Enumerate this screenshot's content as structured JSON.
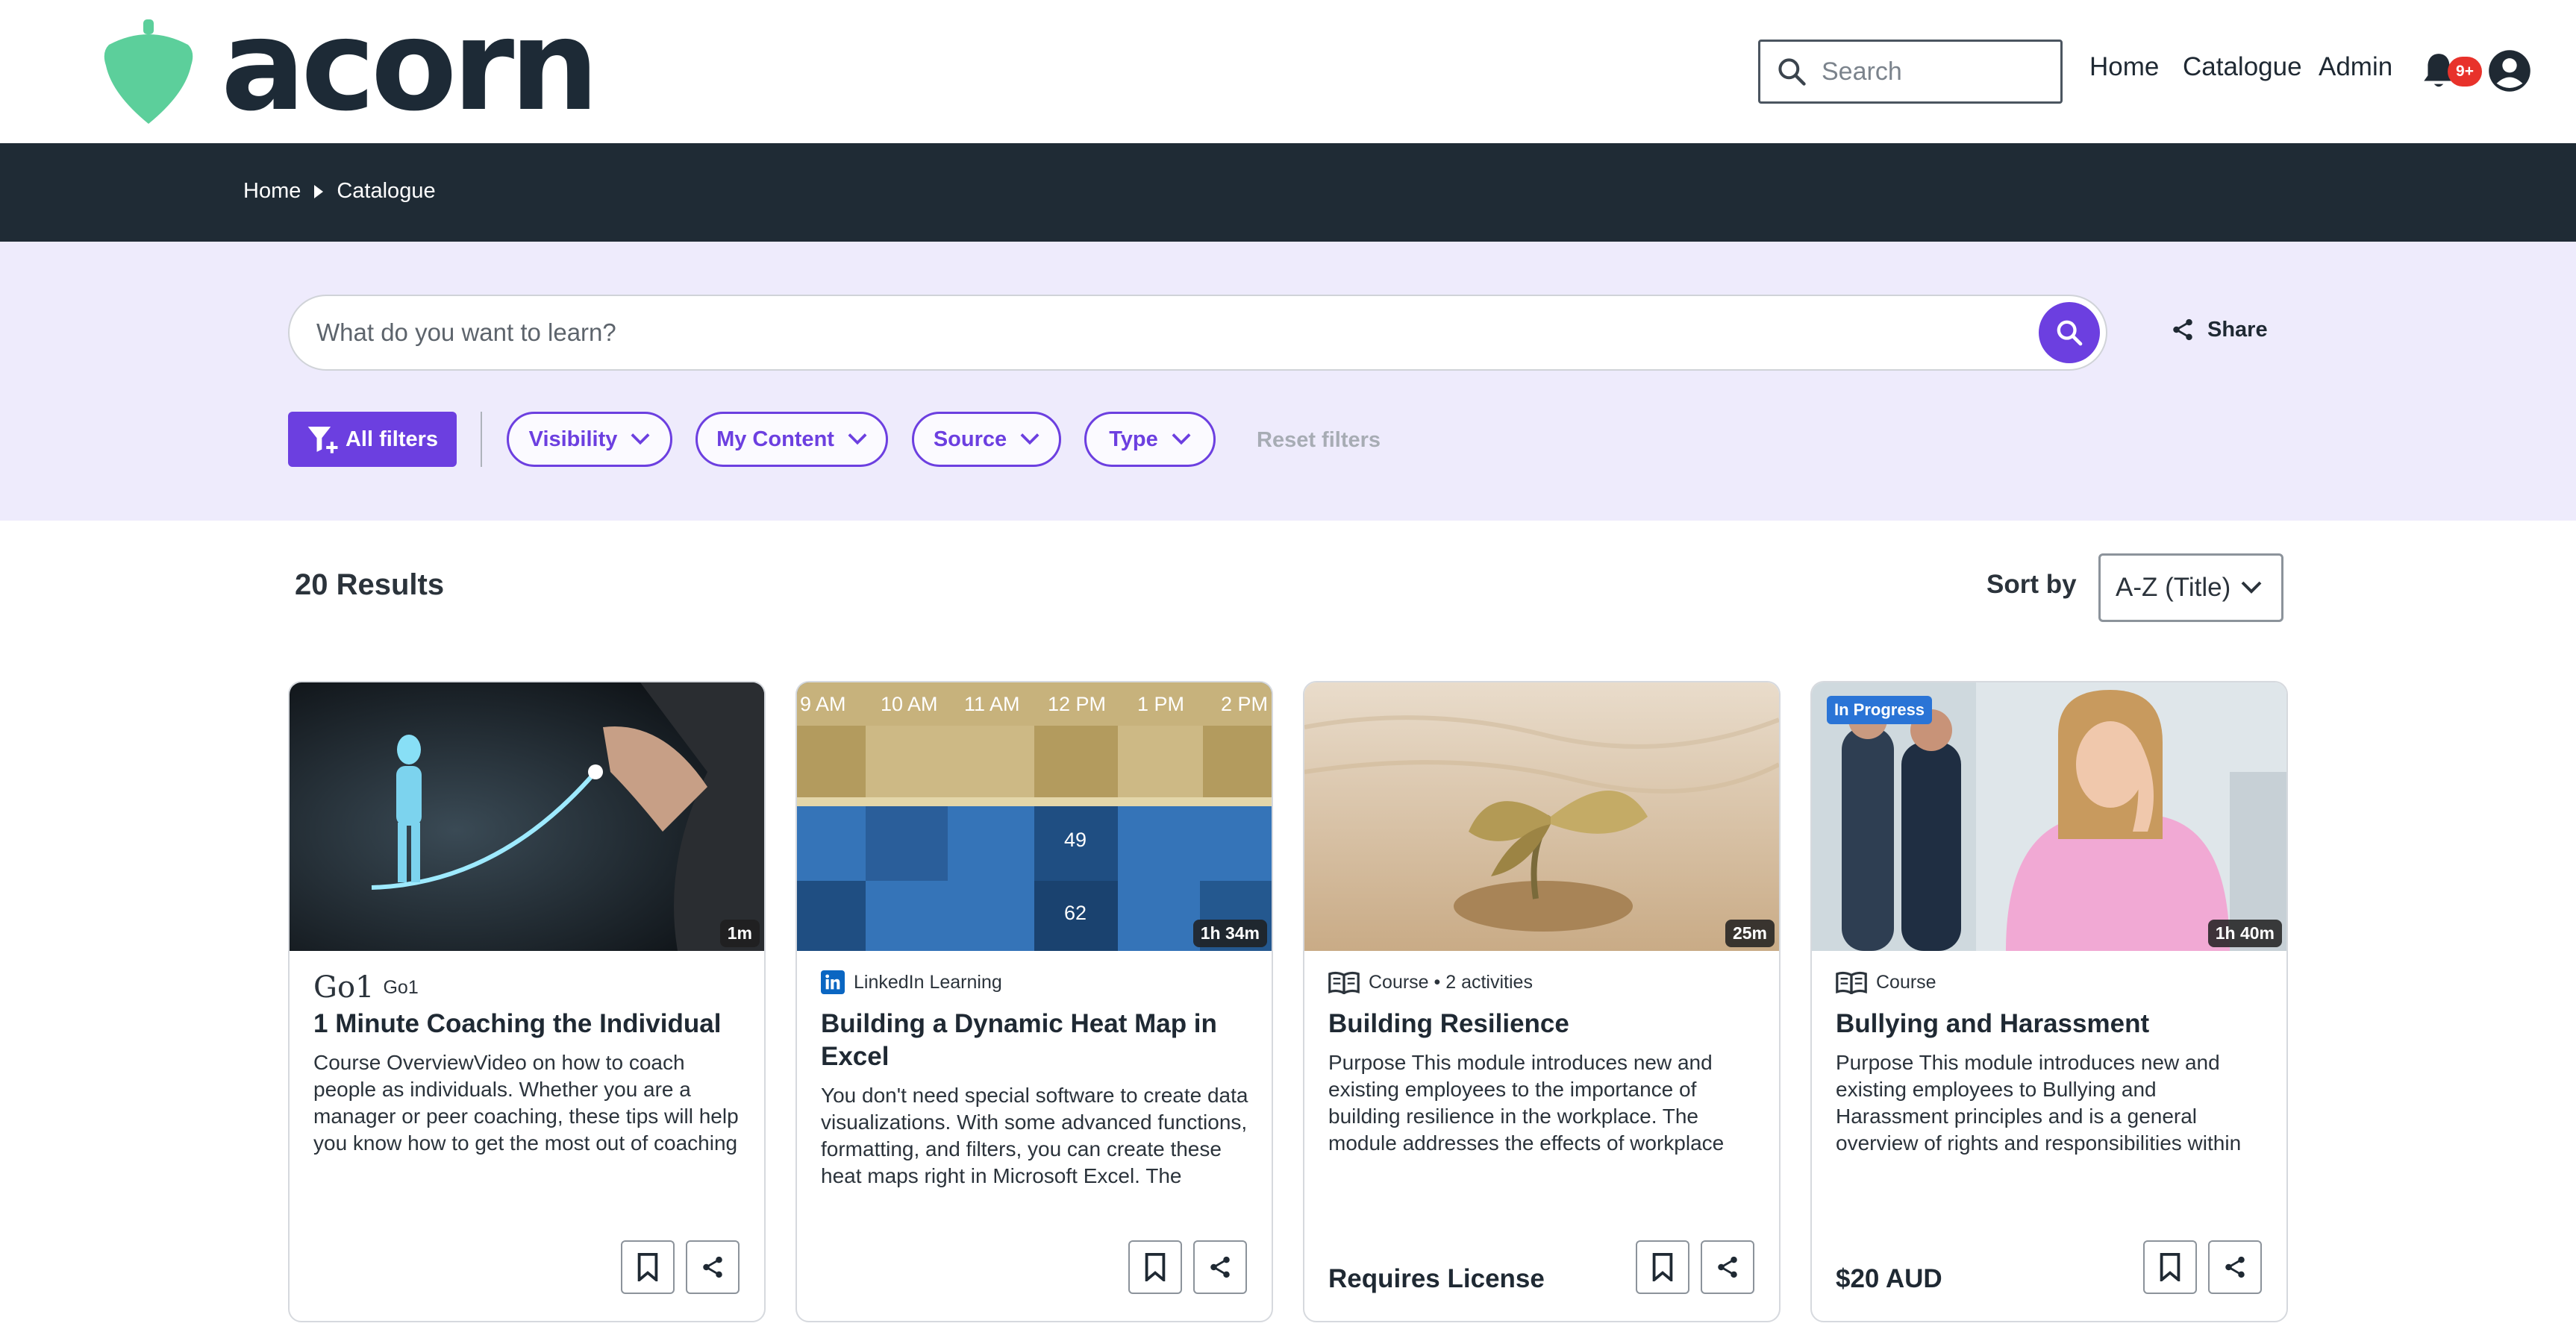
{
  "app": {
    "logo_text": "acorn",
    "accent_color": "#6c3fe0",
    "logo_color": "#5ccf9b"
  },
  "header": {
    "search_placeholder": "Search",
    "nav": [
      "Home",
      "Catalogue",
      "Admin"
    ],
    "notification_badge": "9+"
  },
  "breadcrumb": {
    "items": [
      "Home",
      "Catalogue"
    ]
  },
  "catalogue_search": {
    "placeholder": "What do you want to learn?",
    "share_label": "Share"
  },
  "filters": {
    "all_filters": "All filters",
    "visibility": "Visibility",
    "my_content": "My Content",
    "source": "Source",
    "type": "Type",
    "reset": "Reset filters"
  },
  "results": {
    "count_label": "20 Results",
    "sort_label": "Sort by",
    "sort_value": "A-Z (Title)"
  },
  "cards": [
    {
      "provider": "Go1",
      "provider_logo": "Go1",
      "duration": "1m",
      "title": "1 Minute Coaching the Individual",
      "description": "Course OverviewVideo on how to coach people as individuals. Whether you are a manager or peer coaching, these tips will help you know how to get the most out of coaching people recognising everyone responds in different ways.",
      "footer_label": ""
    },
    {
      "provider": "LinkedIn Learning",
      "provider_logo": "in",
      "duration": "1h 34m",
      "title": "Building a Dynamic Heat Map in Excel",
      "description": "You don't need special software to create data visualizations. With some advanced functions, formatting, and filters, you can create these heat maps right in Microsoft Excel. The techniques shown in this course…",
      "footer_label": "",
      "image_times": [
        "9 AM",
        "10 AM",
        "11 AM",
        "12 PM",
        "1 PM",
        "2 PM"
      ],
      "image_values": [
        "49",
        "62"
      ]
    },
    {
      "provider": "Course • 2 activities",
      "duration": "25m",
      "title": "Building Resilience",
      "description": "Purpose  This module introduces new and existing employees to the importance of building resilience in the workplace.  The module addresses the effects of workplace events on individual stress and goal-achievement, and how building resilience…",
      "footer_label": "Requires License"
    },
    {
      "provider": "Course",
      "duration": "1h 40m",
      "badge": "In Progress",
      "title": "Bullying and Harassment",
      "description": "Purpose  This module introduces new and existing employees to Bullying and Harassment principles and is a general overview of rights and responsibilities within the workplace.   The module addresses various stakeholders with their…",
      "footer_label": "$20 AUD"
    }
  ],
  "icons": {
    "logo": "acorn-icon",
    "search": "search-icon",
    "bell": "bell-icon",
    "user": "user-circle-icon",
    "share": "share-icon",
    "filter": "filter-plus-icon",
    "chevron": "chevron-down-icon",
    "bookmark": "bookmark-icon",
    "course": "book-icon",
    "linkedin": "linkedin-icon"
  }
}
